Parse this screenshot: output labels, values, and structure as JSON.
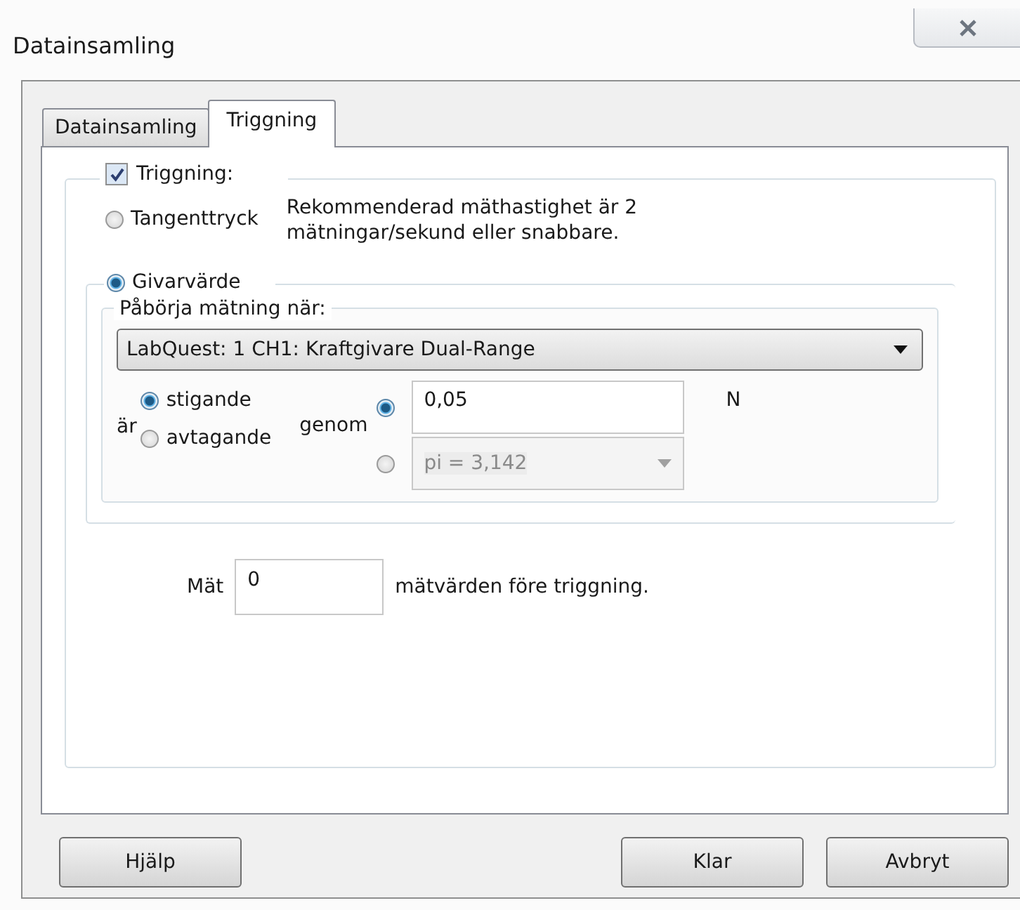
{
  "window": {
    "title": "Datainsamling"
  },
  "tabs": [
    {
      "label": "Datainsamling",
      "selected": false
    },
    {
      "label": "Triggning",
      "selected": true
    }
  ],
  "trigger": {
    "label": "Triggning:",
    "checked": true,
    "info": "Rekommenderad mäthastighet är 2 mätningar/sekund eller snabbare."
  },
  "modes": [
    {
      "label": "Tangenttryck",
      "selected": false
    },
    {
      "label": "Givarvärde",
      "selected": true
    }
  ],
  "condition": {
    "legend": "Påbörja mätning när:",
    "sensor": "LabQuest: 1 CH1: Kraftgivare Dual-Range",
    "is_label": "är",
    "through_label": "genom",
    "unit": "N",
    "directions": [
      {
        "label": "stigande",
        "selected": true
      },
      {
        "label": "avtagande",
        "selected": false
      }
    ],
    "thresholds": [
      {
        "kind": "field",
        "value": "0,05",
        "selected": true,
        "disabled": false
      },
      {
        "kind": "dropdown",
        "value": "pi = 3,142",
        "selected": false,
        "disabled": true
      }
    ]
  },
  "pretrigger": {
    "label": "Mät",
    "value": "0",
    "suffix": "mätvärden före triggning."
  },
  "buttons": [
    {
      "label": "Hjälp"
    },
    {
      "label": "Klar"
    },
    {
      "label": "Avbryt"
    }
  ]
}
